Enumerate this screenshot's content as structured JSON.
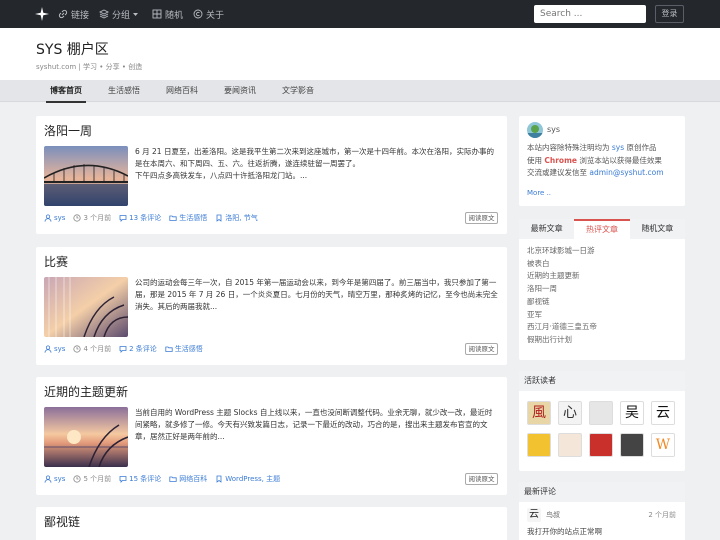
{
  "nav": {
    "items": [
      {
        "label": "链接",
        "icon": "link-icon"
      },
      {
        "label": "分组",
        "icon": "layers-icon"
      },
      {
        "label": "随机",
        "icon": "random-icon"
      },
      {
        "label": "关于",
        "icon": "copyright-icon"
      }
    ],
    "search_placeholder": "Search ...",
    "login_label": "登录"
  },
  "site": {
    "title": "SYS 棚户区",
    "subtitle": "syshut.com | 学习 • 分享 • 创造"
  },
  "categories": [
    "博客首页",
    "生活感悟",
    "网络百科",
    "要闻资讯",
    "文学影音"
  ],
  "posts": [
    {
      "title": "洛阳一周",
      "excerpt": "6 月 21 日夏至，出差洛阳。这是我平生第二次来到这座城市，第一次是十四年前。本次在洛阳，实际办事的是在本周六、和下周四、五、六。往返折腾，遂连续驻留一周罢了。\n下午四点多高铁发车，八点四十许抵洛阳龙门站。...",
      "author": "sys",
      "time": "3 个月前",
      "comments": "13 条评论",
      "category": "生活感悟",
      "tags": "洛阳, 节气",
      "read_label": "阅读原文"
    },
    {
      "title": "比赛",
      "excerpt": "公司的运动会每三年一次，自 2015 年第一届运动会以来，到今年是第四届了。前三届当中，我只参加了第一届，那是 2015 年 7 月 26 日，一个炎炎夏日。七月份的天气，晴空万里，那种炙烤的记忆，至今也尚未完全消失。其后的两届我就...",
      "author": "sys",
      "time": "4 个月前",
      "comments": "2 条评论",
      "category": "生活感悟",
      "tags": "",
      "read_label": "阅读原文"
    },
    {
      "title": "近期的主题更新",
      "excerpt": "当前自用的 WordPress 主题 Slocks 自上线以来，一直也没间断调整代码。业余无聊，就少改一改，最近时间紧略，就多修了一修。今天有兴致发篇日志，记录一下最近的改动，巧合的是，搜出来主题发布官宣的文章，居然正好是两年前的...",
      "author": "sys",
      "time": "5 个月前",
      "comments": "15 条评论",
      "category": "网络百科",
      "tags": "WordPress, 主题",
      "read_label": "阅读原文"
    },
    {
      "title": "鄙视链"
    }
  ],
  "about": {
    "name": "sys",
    "line1_prefix": "本站内容除特殊注明均为 ",
    "line1_hl": "sys",
    "line1_suffix": " 原创作品",
    "line2_prefix": "使用 ",
    "line2_bold": "Chrome",
    "line2_suffix": " 浏览本站以获得最佳效果",
    "line3_prefix": "交流或建议发信至 ",
    "line3_email": "admin@syshut.com",
    "more": "More .."
  },
  "hot": {
    "tabs": [
      "最新文章",
      "热评文章",
      "随机文章"
    ],
    "active_tab": 1,
    "items": [
      "北京环球影城一日游",
      "被表白",
      "近期的主题更新",
      "洛阳一周",
      "鄙视链",
      "亚军",
      "西江月·道德三皇五帝",
      "假期出行计划"
    ]
  },
  "readers": {
    "title": "活跃读者",
    "list": [
      {
        "glyph": "風",
        "bg": "#e8d6a6",
        "fg": "#b02020"
      },
      {
        "glyph": "心",
        "bg": "#f3f3f3",
        "fg": "#333"
      },
      {
        "glyph": "",
        "bg": "#e6e6e6",
        "fg": "#111"
      },
      {
        "glyph": "吴",
        "bg": "#fff",
        "fg": "#111"
      },
      {
        "glyph": "云",
        "bg": "#fff",
        "fg": "#111"
      },
      {
        "glyph": "",
        "bg": "#f2c230",
        "fg": "#111"
      },
      {
        "glyph": "",
        "bg": "#f5e6da",
        "fg": "#333"
      },
      {
        "glyph": "",
        "bg": "#c9302c",
        "fg": "#fff"
      },
      {
        "glyph": "",
        "bg": "#444",
        "fg": "#fff"
      },
      {
        "glyph": "W",
        "bg": "#fff",
        "fg": "#f08a24"
      }
    ]
  },
  "comment": {
    "title": "最新评论",
    "avatar_glyph": "云",
    "name": "鸟叔",
    "time": "2 个月前",
    "text": "我打开你的站点正常啊"
  },
  "colors": {
    "accent": "#3a7bd5",
    "hot": "#d9534f",
    "navbar": "#24272c"
  }
}
